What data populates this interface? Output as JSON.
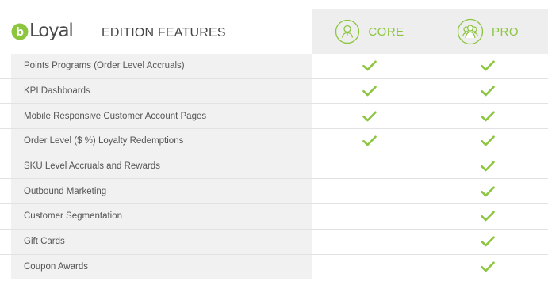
{
  "brand": {
    "logo_text": "Loyal",
    "logo_letter": "b",
    "accent_color": "#8cc63f"
  },
  "header": {
    "title": "EDITION FEATURES"
  },
  "editions": [
    {
      "label": "CORE",
      "icon": "single-user-icon"
    },
    {
      "label": "PRO",
      "icon": "user-group-icon"
    }
  ],
  "features": [
    {
      "name": "Points Programs (Order Level Accruals)",
      "core": true,
      "pro": true
    },
    {
      "name": "KPI Dashboards",
      "core": true,
      "pro": true
    },
    {
      "name": "Mobile Responsive Customer Account Pages",
      "core": true,
      "pro": true
    },
    {
      "name": "Order Level ($ %) Loyalty Redemptions",
      "core": true,
      "pro": true
    },
    {
      "name": "SKU Level Accruals and Rewards",
      "core": false,
      "pro": true
    },
    {
      "name": "Outbound Marketing",
      "core": false,
      "pro": true
    },
    {
      "name": "Customer Segmentation",
      "core": false,
      "pro": true
    },
    {
      "name": "Gift Cards",
      "core": false,
      "pro": true
    },
    {
      "name": "Coupon Awards",
      "core": false,
      "pro": true
    }
  ]
}
